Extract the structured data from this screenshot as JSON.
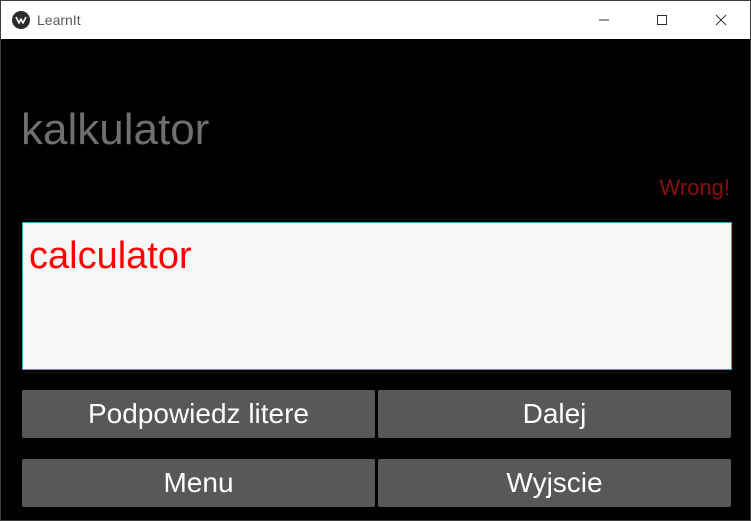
{
  "window": {
    "title": "LearnIt",
    "icon": "kivy-logo-icon",
    "controls": [
      "minimize-icon",
      "maximize-icon",
      "close-icon"
    ]
  },
  "main": {
    "question_word": "kalkulator",
    "feedback": "Wrong!",
    "answer_value": "calculator",
    "buttons": {
      "hint": "Podpowiedz litere",
      "next": "Dalej",
      "menu": "Menu",
      "exit": "Wyjscie"
    }
  },
  "colors": {
    "background": "#000000",
    "question_text": "#6f6f6f",
    "feedback_text": "#8a0f0f",
    "answer_text": "#ff0000",
    "answer_box_bg": "#f7f7f7",
    "answer_box_border": "#3aa3d6",
    "button_bg": "#585858",
    "button_text": "#ffffff"
  }
}
